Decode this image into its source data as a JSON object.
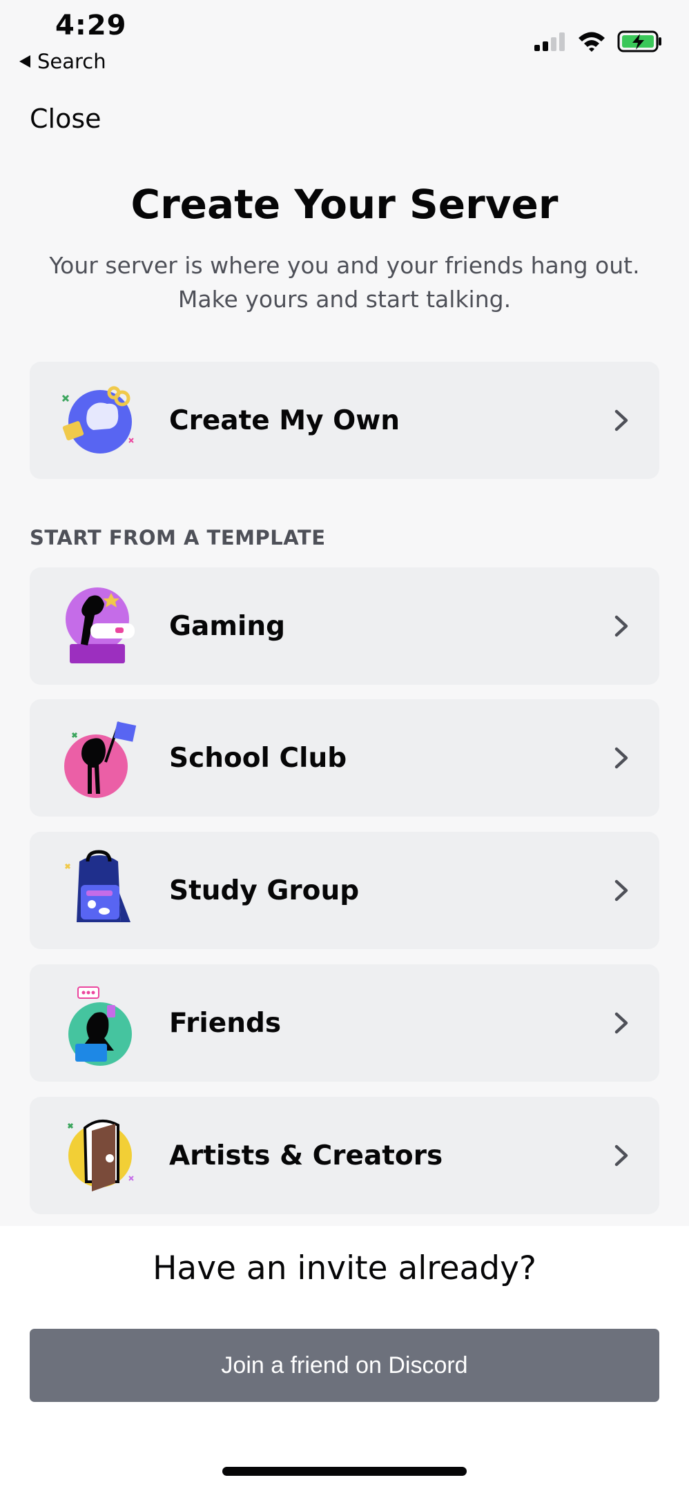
{
  "status": {
    "time": "4:29",
    "back_label": "Search"
  },
  "header": {
    "close_label": "Close"
  },
  "main": {
    "title": "Create Your Server",
    "subtitle_line1": "Your server is where you and your friends hang out.",
    "subtitle_line2": "Make yours and start talking.",
    "create_own_label": "Create My Own",
    "section_label": "START FROM A TEMPLATE",
    "templates": [
      {
        "label": "Gaming"
      },
      {
        "label": "School Club"
      },
      {
        "label": "Study Group"
      },
      {
        "label": "Friends"
      },
      {
        "label": "Artists & Creators"
      }
    ]
  },
  "footer": {
    "invite_heading": "Have an invite already?",
    "join_label": "Join a friend on Discord"
  },
  "colors": {
    "background": "#f7f7f8",
    "card": "#eeeff1",
    "join_button": "#6d717c",
    "battery_green": "#3ac759"
  }
}
